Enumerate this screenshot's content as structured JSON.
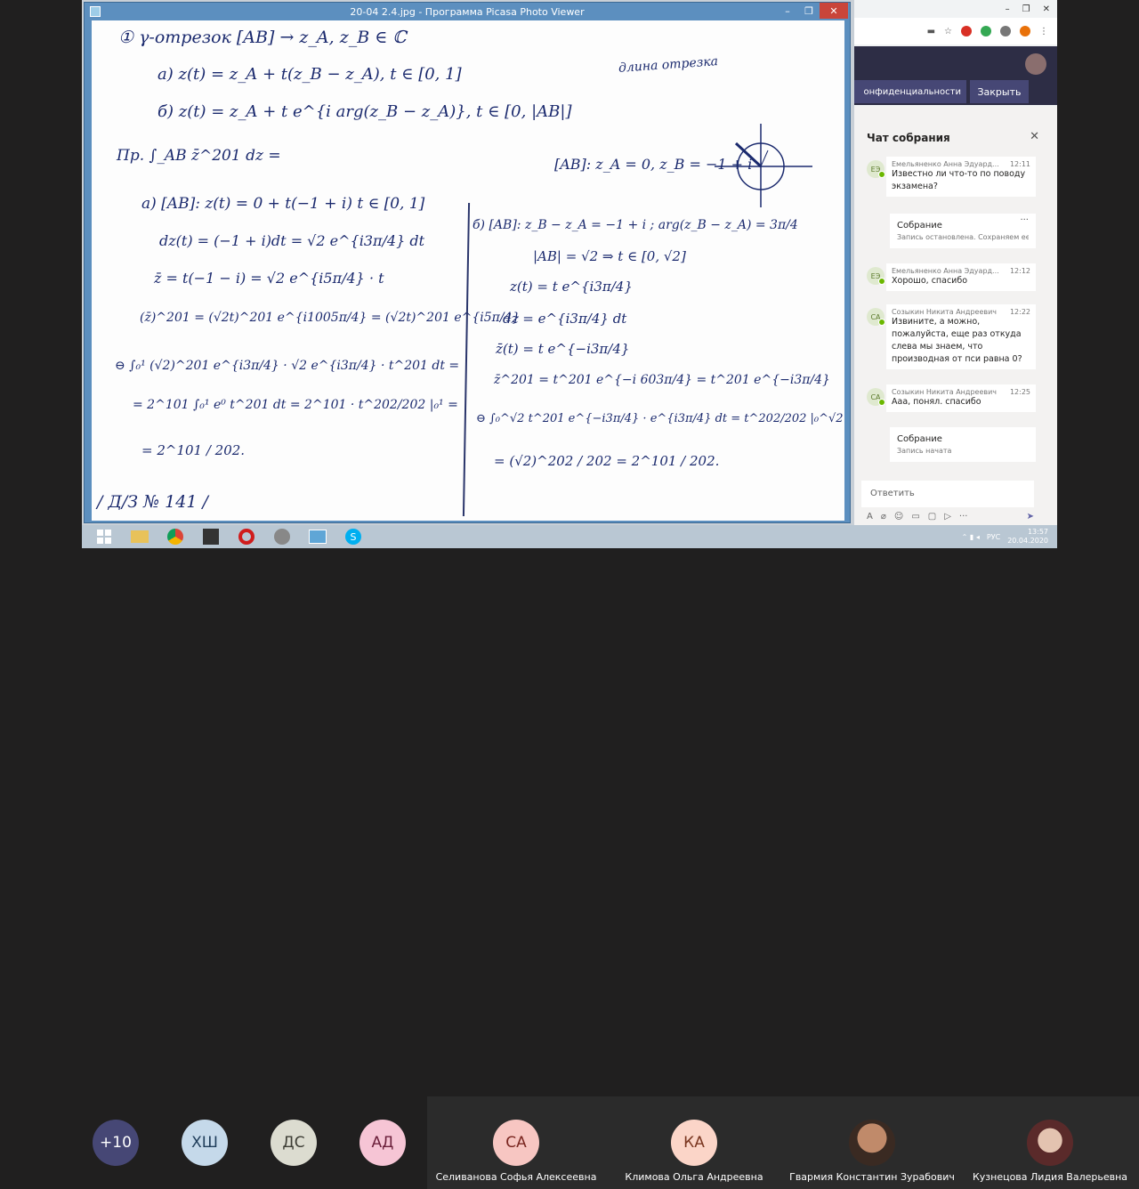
{
  "picasa": {
    "title": "20-04 2.4.jpg - Программа Picasa Photo Viewer",
    "controls": [
      "–",
      "❐",
      "✕"
    ]
  },
  "handwriting": {
    "l1": "① γ-отрезок [AB] → z_A, z_B ∈ ℂ",
    "l2": "а) z(t) = z_A + t(z_B − z_A),  t ∈ [0, 1]",
    "l3": "б) z(t) = z_A + t e^{i arg(z_B − z_A)},   t ∈ [0, |AB|]",
    "note": "длина отрезка",
    "l4": "Пр.  ∫_AB z̄^201 dz =",
    "l4b": "[AB]: z_A = 0,  z_B = −1 + i",
    "l5": "а) [AB]: z(t) = 0 + t(−1 + i)  t ∈ [0, 1]",
    "l6": "dz(t) = (−1 + i)dt = √2 e^{i3π/4} dt",
    "l7": "z̄ = t(−1 − i) = √2 e^{i5π/4} · t",
    "l8": "(z̄)^201 = (√2t)^201 e^{i1005π/4} = (√2t)^201 e^{i5π/4}",
    "l9": "⊖ ∫₀¹ (√2)^201 e^{i3π/4} · √2 e^{i3π/4} · t^201 dt =",
    "l10": "= 2^101 ∫₀¹ e⁰ t^201 dt = 2^101 · t^202/202 |₀¹ =",
    "l11": "= 2^101 / 202.",
    "l12": "/ Д/З  № 141 /",
    "r1": "б) [AB]: z_B − z_A = −1 + i ;  arg(z_B − z_A) = 3π/4",
    "r2": "|AB| = √2  ⇒  t ∈ [0, √2]",
    "r3": "z(t) = t e^{i3π/4}",
    "r4": "dz = e^{i3π/4} dt",
    "r5": "z̄(t) = t e^{−i3π/4}",
    "r6": "z̄^201 = t^201 e^{−i 603π/4} = t^201 e^{−i3π/4}",
    "r7": "⊖ ∫₀^√2 t^201 e^{−i3π/4} · e^{i3π/4} dt = t^202/202 |₀^√2 =",
    "r8": "= (√2)^202 / 202  =  2^101 / 202."
  },
  "browser": {
    "window_controls": [
      "–",
      "❐",
      "✕"
    ],
    "privacy_label": "онфиденциальности",
    "close_meeting": "Закрыть"
  },
  "chat": {
    "title": "Чат собрания",
    "messages": [
      {
        "initials": "ЕЭ",
        "author": "Емельяненко Анна Эдуард...",
        "time": "12:11",
        "text": "Известно ли что-то по поводу экзамена?"
      },
      {
        "initials": "ЕЭ",
        "author": "Емельяненко Анна Эдуард...",
        "time": "12:12",
        "text": "Хорошо, спасибо"
      },
      {
        "initials": "СА",
        "author": "Созыкин Никита Андреевич",
        "time": "12:22",
        "text": "Извините, а можно, пожалуйста, еще раз откуда слева мы знаем, что производная от пси равна 0?"
      },
      {
        "initials": "СА",
        "author": "Созыкин Никита Андреевич",
        "time": "12:25",
        "text": "Ааа, понял. спасибо"
      }
    ],
    "system1": {
      "title": "Собрание",
      "sub": "Запись остановлена. Сохраняем ее в..."
    },
    "system2": {
      "title": "Собрание",
      "sub": "Запись начата"
    },
    "reply_placeholder": "Ответить"
  },
  "taskbar": {
    "lang": "РУС",
    "time": "13:57",
    "date": "20.04.2020"
  },
  "participants": {
    "more": "+10",
    "circles": [
      {
        "initials": "ХШ",
        "bg": "#c5d9ea",
        "fg": "#1f3d5a"
      },
      {
        "initials": "ДС",
        "bg": "#dcdcd0",
        "fg": "#3d3d35"
      },
      {
        "initials": "АД",
        "bg": "#f6c5d5",
        "fg": "#6b1f3a"
      }
    ],
    "tiles": [
      {
        "initials": "СА",
        "name": "Селиванова Софья Алексеевна",
        "bg": "#f7c6c2",
        "fg": "#7a2620"
      },
      {
        "initials": "КА",
        "name": "Климова Ольга Андреевна",
        "bg": "#fbd5c8",
        "fg": "#7a3620"
      },
      {
        "initials": "",
        "name": "Гвармия Константин Зурабович"
      },
      {
        "initials": "",
        "name": "Кузнецова Лидия Валерьевна"
      }
    ]
  }
}
